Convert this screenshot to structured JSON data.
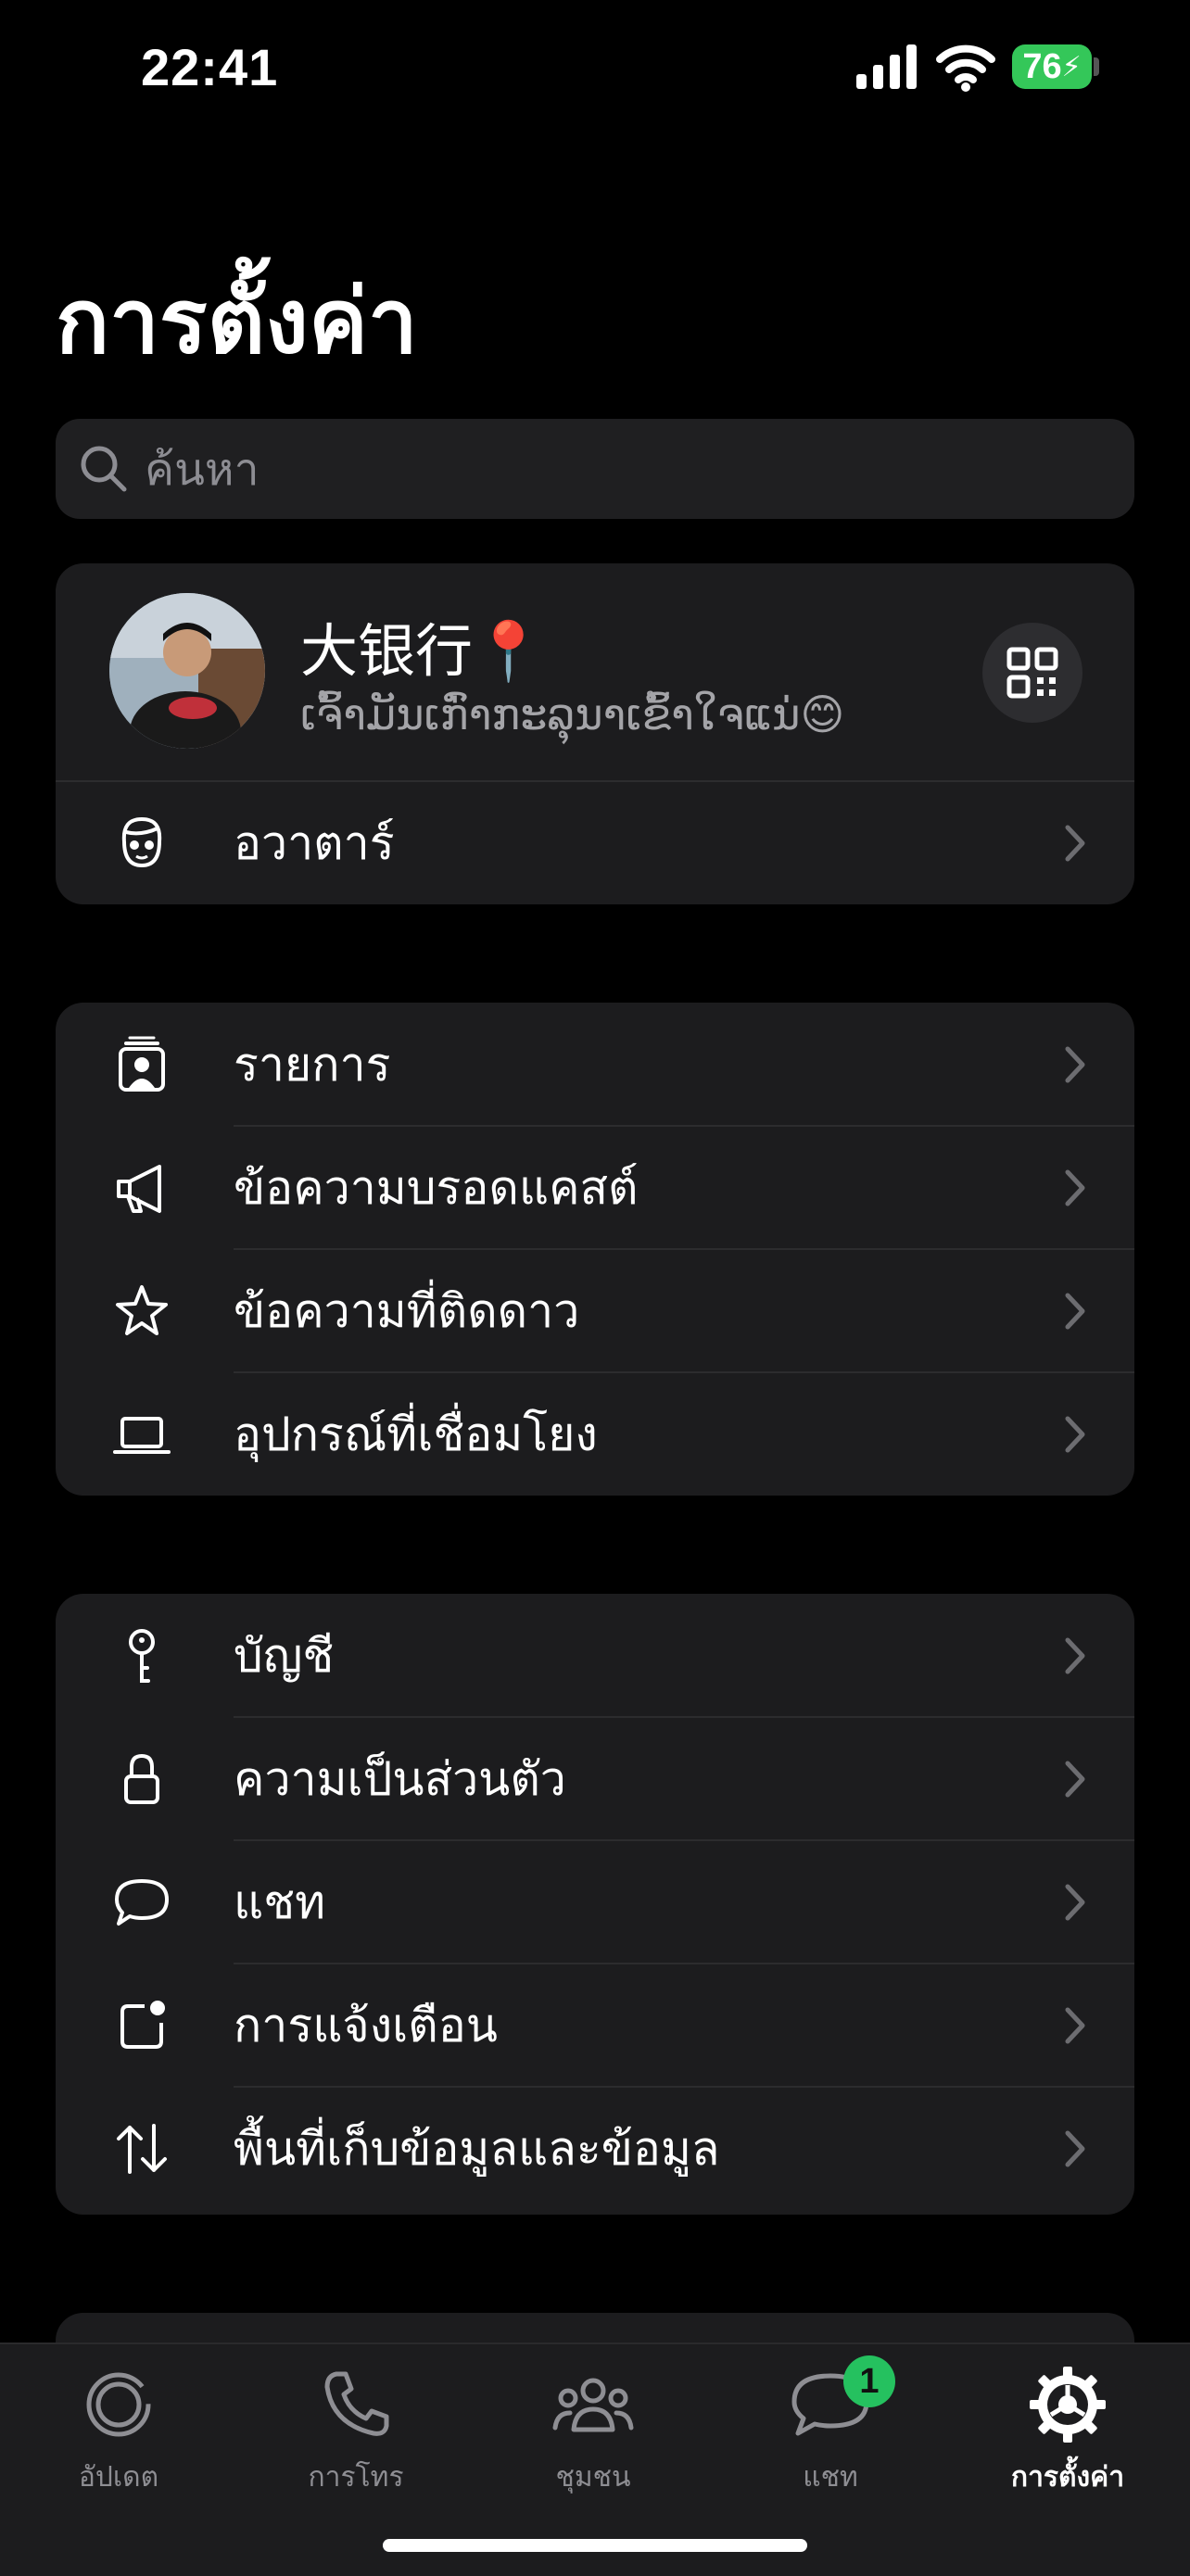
{
  "status_bar": {
    "time": "22:41",
    "battery": "76"
  },
  "title": "การตั้งค่า",
  "search": {
    "placeholder": "ค้นหา"
  },
  "profile": {
    "name": "大银行📍",
    "status": "ເຈົ້າມັນເກົ່າກະລຸນາເຂົ້າໃຈແນ່😊",
    "avatar_row_label": "อวาตาร์"
  },
  "group1": [
    {
      "label": "รายการ",
      "icon": "contact-list-icon"
    },
    {
      "label": "ข้อความบรอดแคสต์",
      "icon": "megaphone-icon"
    },
    {
      "label": "ข้อความที่ติดดาว",
      "icon": "star-icon"
    },
    {
      "label": "อุปกรณ์ที่เชื่อมโยง",
      "icon": "laptop-icon"
    }
  ],
  "group2": [
    {
      "label": "บัญชี",
      "icon": "key-icon"
    },
    {
      "label": "ความเป็นส่วนตัว",
      "icon": "lock-icon"
    },
    {
      "label": "แชท",
      "icon": "chat-bubble-icon"
    },
    {
      "label": "การแจ้งเตือน",
      "icon": "notification-icon"
    },
    {
      "label": "พื้นที่เก็บข้อมูลและข้อมูล",
      "icon": "data-arrows-icon"
    }
  ],
  "tabs": [
    {
      "label": "อัปเดต",
      "icon": "updates-icon"
    },
    {
      "label": "การโทร",
      "icon": "phone-icon"
    },
    {
      "label": "ชุมชน",
      "icon": "communities-icon"
    },
    {
      "label": "แชท",
      "icon": "chats-icon",
      "badge": "1"
    },
    {
      "label": "การตั้งค่า",
      "icon": "settings-icon",
      "active": true
    }
  ],
  "colors": {
    "accent": "#25c15f",
    "card": "#1c1c1e",
    "background": "#000000"
  }
}
